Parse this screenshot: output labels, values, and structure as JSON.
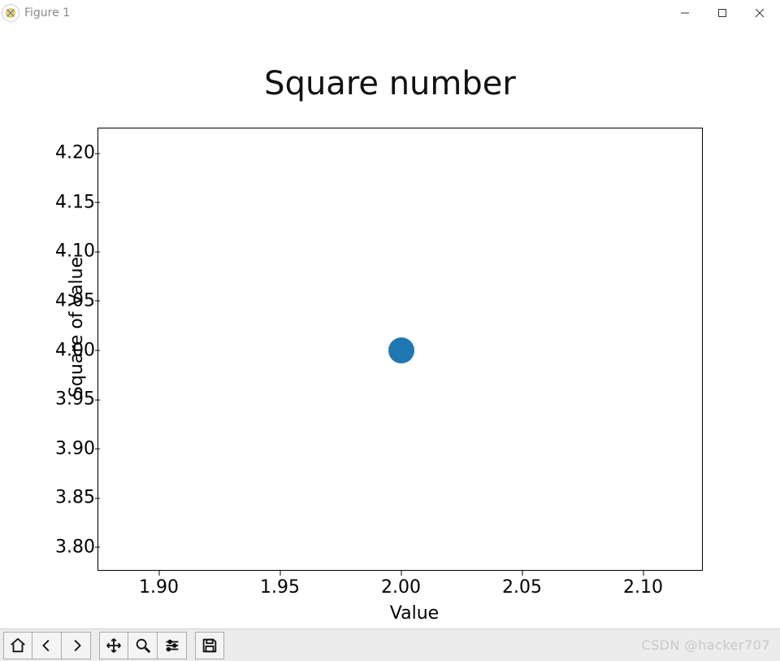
{
  "window": {
    "title": "Figure 1"
  },
  "chart_data": {
    "type": "scatter",
    "title": "Square number",
    "xlabel": "Value",
    "ylabel": "Square of Value",
    "x": [
      2.0
    ],
    "y": [
      4.0
    ],
    "xlim": [
      1.875,
      2.125
    ],
    "ylim": [
      3.775,
      4.225
    ],
    "xticks": [
      1.9,
      1.95,
      2.0,
      2.05,
      2.1
    ],
    "xtick_labels": [
      "1.90",
      "1.95",
      "2.00",
      "2.05",
      "2.10"
    ],
    "yticks": [
      3.8,
      3.85,
      3.9,
      3.95,
      4.0,
      4.05,
      4.1,
      4.15,
      4.2
    ],
    "ytick_labels": [
      "3.80",
      "3.85",
      "3.90",
      "3.95",
      "4.00",
      "4.05",
      "4.10",
      "4.15",
      "4.20"
    ],
    "point_color": "#1f77b4"
  },
  "toolbar": {
    "items": [
      "home",
      "back",
      "forward",
      "pan",
      "zoom",
      "configure",
      "save"
    ]
  },
  "watermark": "CSDN @hacker707"
}
